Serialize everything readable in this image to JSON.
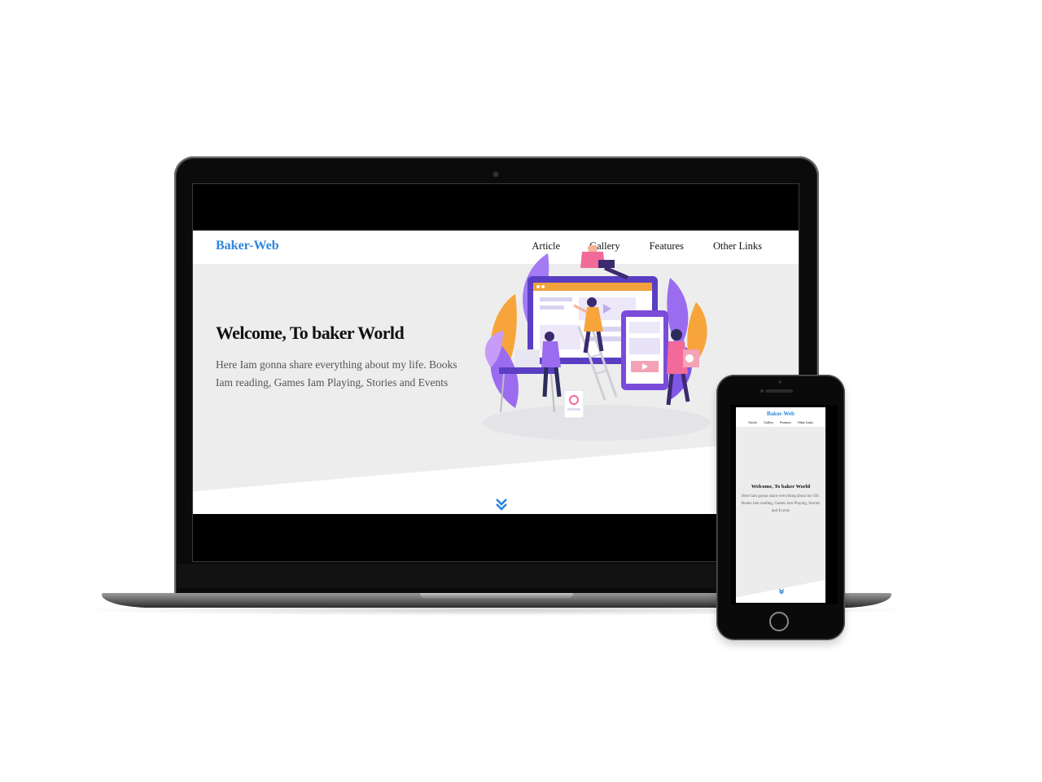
{
  "desktop_site": {
    "brand": "Baker-Web",
    "nav": [
      "Article",
      "Gallery",
      "Features",
      "Other Links"
    ],
    "hero_title": "Welcome, To baker World",
    "hero_text": "Here Iam gonna share everything about my life. Books Iam reading, Games Iam Playing, Stories and Events"
  },
  "mobile_site": {
    "brand": "Baker-Web",
    "nav": [
      "Article",
      "Gallery",
      "Features",
      "Other Links"
    ],
    "hero_title": "Welcome, To baker World",
    "hero_text": "Here Iam gonna share everything about my life. Books Iam reading, Games Iam Playing, Stories and Events"
  },
  "colors": {
    "brand_blue": "#2e86de",
    "hero_gray": "#ededed",
    "title_text": "#111111",
    "body_text": "#555555"
  },
  "icons": {
    "scroll_down": "double-chevron-down-icon",
    "illustration": "web-design-team-illustration"
  }
}
